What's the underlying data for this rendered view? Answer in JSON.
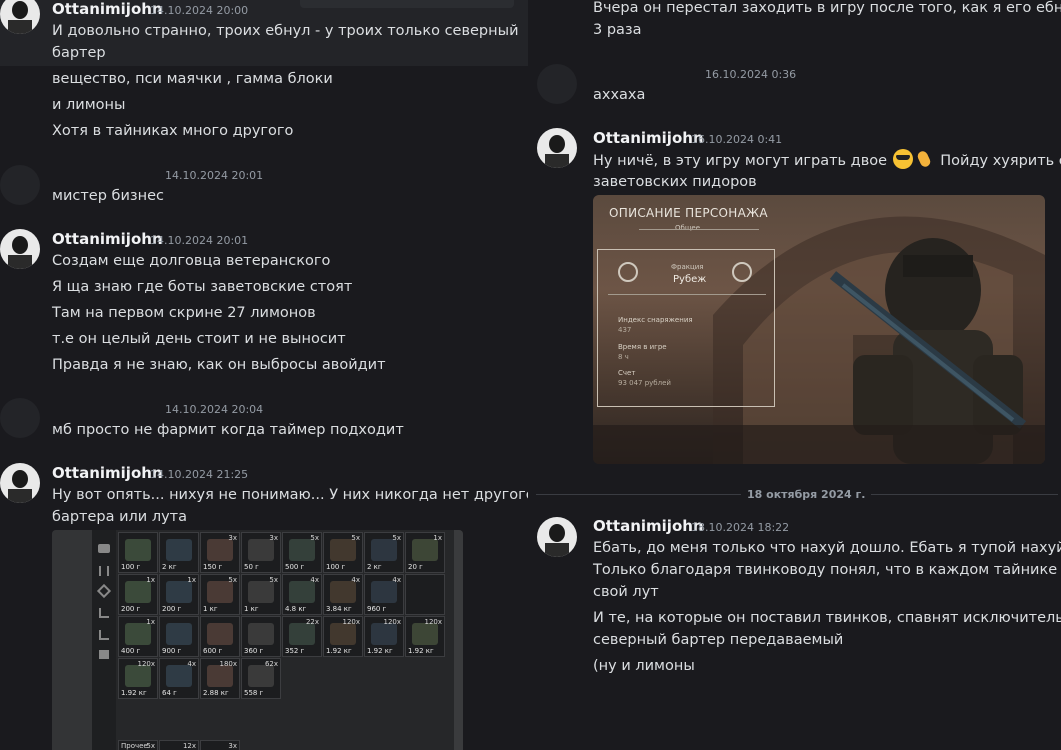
{
  "left": {
    "msg1": {
      "username": "Ottanimijohn",
      "timestamp": "14.10.2024 20:00",
      "lines": [
        "И довольно странно, троих ебнул - у троих только северный",
        "бартер",
        "вещество, пси маячки , гамма блоки",
        "и лимоны",
        "Хотя в тайниках много другого"
      ]
    },
    "msg2": {
      "timestamp": "14.10.2024 20:01",
      "text": "мистер бизнес"
    },
    "msg3": {
      "username": "Ottanimijohn",
      "timestamp": "14.10.2024 20:01",
      "lines": [
        "Создам еще долговца ветеранского",
        "Я ща знаю где боты заветовские стоят",
        "Там на первом скрине 27 лимонов",
        "т.е он целый день стоит и не выносит",
        "Правда я не знаю, как он выбросы авойдит"
      ]
    },
    "msg4": {
      "timestamp": "14.10.2024 20:04",
      "text": "мб просто не фармит когда таймер подходит"
    },
    "msg5": {
      "username": "Ottanimijohn",
      "timestamp": "14.10.2024 21:25",
      "lines": [
        "Ну вот опять... нихуя не понимаю... У них никогда нет другого",
        "бартера или лута"
      ]
    },
    "inventory": {
      "cells": [
        {
          "count": "",
          "value": "100 г"
        },
        {
          "count": "",
          "value": "2 кг"
        },
        {
          "count": "3x",
          "value": "150 г"
        },
        {
          "count": "3x",
          "value": "50 г"
        },
        {
          "count": "5x",
          "value": "500 г"
        },
        {
          "count": "5x",
          "value": "100 г"
        },
        {
          "count": "5x",
          "value": "2 кг"
        },
        {
          "count": "1x",
          "value": "20 г"
        },
        {
          "count": "1x",
          "value": "200 г"
        },
        {
          "count": "1x",
          "value": "200 г"
        },
        {
          "count": "5x",
          "value": "1 кг"
        },
        {
          "count": "5x",
          "value": "1 кг"
        },
        {
          "count": "4x",
          "value": "4.8 кг"
        },
        {
          "count": "4x",
          "value": "3.84 кг"
        },
        {
          "count": "4x",
          "value": "960 г"
        },
        {
          "count": "",
          "value": ""
        },
        {
          "count": "1x",
          "value": "400 г"
        },
        {
          "count": "",
          "value": "900 г"
        },
        {
          "count": "",
          "value": "600 г"
        },
        {
          "count": "",
          "value": "360 г"
        },
        {
          "count": "22x",
          "value": "352 г"
        },
        {
          "count": "120x",
          "value": "1.92 кг"
        },
        {
          "count": "120x",
          "value": "1.92 кг"
        },
        {
          "count": "120x",
          "value": "1.92 кг"
        },
        {
          "count": "120x",
          "value": "1.92 кг"
        },
        {
          "count": "4x",
          "value": "64 г"
        },
        {
          "count": "180x",
          "value": "2.88 кг"
        },
        {
          "count": "62x",
          "value": "558 г"
        }
      ],
      "bottom_row": [
        {
          "label": "Прочее",
          "count": "5x"
        },
        {
          "label": "",
          "count": "12x"
        },
        {
          "label": "",
          "count": "3x"
        }
      ]
    }
  },
  "right": {
    "msgA": {
      "lines": [
        "Вчера он перестал заходить в игру после того, как я его ебнул",
        "3 раза"
      ]
    },
    "msgB": {
      "timestamp": "16.10.2024 0:36",
      "text": "аххаха"
    },
    "msgC": {
      "username": "Ottanimijohn",
      "timestamp": "16.10.2024 0:41",
      "line1a": "Ну ничё, в эту игру могут играть двое",
      "line1b": "Пойду хуярить его",
      "line2": "заветовских пидоров",
      "emojis": [
        "sunglasses-emoji",
        "call-me-hand-emoji"
      ]
    },
    "screenshot": {
      "heading": "ОПИСАНИЕ ПЕРСОНАЖА",
      "subheading": "Общее",
      "faction_label": "Фракция",
      "faction_value": "Рубеж",
      "gear_label": "Индекс снаряжения",
      "gear_value": "437",
      "time_label": "Время в игре",
      "time_value": "8 ч",
      "score_label": "Счет",
      "score_value": "93 047 рублей"
    },
    "date_divider": "18 октября 2024 г.",
    "msgD": {
      "username": "Ottanimijohn",
      "timestamp": "18.10.2024 18:22",
      "lines": [
        "Ебать, до меня только что нахуй дошло. Ебать я тупой нахуй.",
        "Только благодаря твинководу понял, что в каждом тайнике",
        "свой лут",
        "И те, на которые он поставил твинков, спавнят исключительно",
        "северный бартер передаваемый",
        "(ну и лимоны"
      ]
    }
  }
}
